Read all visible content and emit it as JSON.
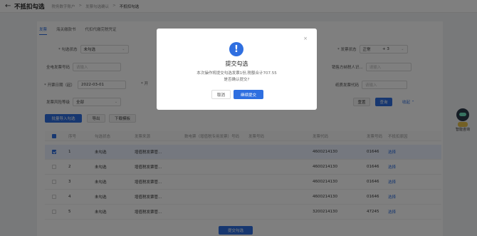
{
  "header": {
    "title": "不抵扣勾选",
    "breadcrumbs": [
      "税务数字账户",
      "发票勾选确认",
      "不抵扣勾选"
    ]
  },
  "tabs": [
    "发票",
    "海关缴款书",
    "代扣代缴完税凭证"
  ],
  "filters": {
    "gxzt_label": "* 勾选状态",
    "gxzt_value": "未勾选",
    "fpzt_label": "* 发票状态",
    "fpzt_value": "正常",
    "fpzt_extra": "+ 3",
    "qdfphm_label": "全电发票号码",
    "qdfphm_placeholder": "请输入",
    "xsfnsrsbh_label": "销售方纳税人识...",
    "xsfnsrsbh_placeholder": "请输入",
    "kprq_label": "* 开票日期（起）",
    "kprq_value": "2022-03-01",
    "kprq2_label": "* 开",
    "zzfpdm_label": "纸质发票代码",
    "zzfpdm_placeholder": "请输入",
    "fxdj_label": "发票风险等级",
    "fxdj_value": "全部"
  },
  "actions": {
    "reset": "重置",
    "query": "查询",
    "collapse": "收起",
    "import": "批量导入勾选",
    "export": "导出",
    "download_template": "下载模板"
  },
  "table": {
    "headers": [
      "序号",
      "勾选状态",
      "发票来源",
      "数电票（增值税专用发票）号码",
      "发票号码",
      "全电发票号码",
      "发票代码",
      "发票号码",
      "不抵扣原因"
    ],
    "rows": [
      {
        "no": "1",
        "status": "未勾选",
        "source": "增值税发票管...",
        "code": "4600214130",
        "num": "01646",
        "op": "选择",
        "checked": true
      },
      {
        "no": "2",
        "status": "未勾选",
        "source": "增值税发票管...",
        "code": "4600214130",
        "num": "01646",
        "op": "选择",
        "checked": false
      },
      {
        "no": "3",
        "status": "未勾选",
        "source": "增值税发票管...",
        "code": "4600214130",
        "num": "01646",
        "op": "选择",
        "checked": false
      },
      {
        "no": "4",
        "status": "未勾选",
        "source": "增值税发票管...",
        "code": "4600214130",
        "num": "01646",
        "op": "选择",
        "checked": false
      },
      {
        "no": "5",
        "status": "未勾选",
        "source": "增值税发票管...",
        "code": "3200214130",
        "num": "47245",
        "op": "选择",
        "checked": false
      }
    ]
  },
  "footer": {
    "submit": "提交勾选"
  },
  "assistant": {
    "label": "智能咨询"
  },
  "modal": {
    "title": "提交勾选",
    "line1": "本次操作将提交勾选发票1份,税额合计707.55",
    "line2": "是否确认提交?",
    "cancel": "取消",
    "confirm": "继续提交",
    "close": "×"
  },
  "colors": {
    "primary": "#2f6fe0",
    "mask": "rgba(0,0,0,0.5)"
  }
}
